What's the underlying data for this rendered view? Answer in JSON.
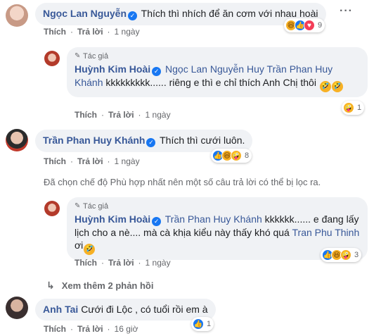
{
  "comments": [
    {
      "name": "Ngọc Lan Nguyễn",
      "text": "Thích thì nhích để ăn cơm với nhau hoài",
      "actions": {
        "like": "Thích",
        "reply": "Trả lời",
        "time": "1 ngày"
      },
      "reactions": {
        "icons": [
          "haha-icon",
          "like-icon",
          "love-icon"
        ],
        "count": "9"
      },
      "avatar_color": "#d9b8a6"
    },
    {
      "author_tag": "Tác giả",
      "name": "Huỳnh Kim Hoài",
      "mention1": "Ngọc Lan Nguyễn Huy",
      "mention2": "Trần Phan Huy Khánh",
      "text": "kkkkkkkkk...... riêng e thì e chỉ thích Anh Chị thôi",
      "actions": {
        "like": "Thích",
        "reply": "Trả lời",
        "time": "1 ngày"
      },
      "reactions": {
        "icons": [
          "care-icon"
        ],
        "count": "1"
      },
      "avatar_color": "#b33a2a"
    },
    {
      "name": "Trần Phan Huy Khánh",
      "text": "Thích thì cưới luôn.",
      "actions": {
        "like": "Thích",
        "reply": "Trả lời",
        "time": "1 ngày"
      },
      "reactions": {
        "icons": [
          "like-icon",
          "haha-icon",
          "care-icon"
        ],
        "count": "8"
      },
      "avatar_color": "#c0392b"
    },
    {
      "author_tag": "Tác giả",
      "name": "Huỳnh Kim Hoài",
      "mention1": "Trần Phan Huy Khánh",
      "text1": "kkkkkk...... e đang lấy lịch cho a nè.... mà cà khịa kiểu này thấy khó quá",
      "mention2": "Tran Phu Thinh",
      "text2": "ơi",
      "actions": {
        "like": "Thích",
        "reply": "Trả lời",
        "time": "1 ngày"
      },
      "reactions": {
        "icons": [
          "like-icon",
          "haha-icon",
          "care-icon"
        ],
        "count": "3"
      },
      "avatar_color": "#b33a2a"
    },
    {
      "name": "Anh Tai",
      "text": "Cưới đi Lộc , có tuổi rồi em à",
      "actions": {
        "like": "Thích",
        "reply": "Trả lời",
        "time": "16 giờ"
      },
      "reactions": {
        "icons": [
          "like-icon"
        ],
        "count": "1"
      },
      "avatar_color": "#5a4a4a"
    }
  ],
  "filter_note": "Đã chọn chế độ Phù hợp nhất nên một số câu trả lời có thể bị lọc ra.",
  "more_replies": "Xem thêm 2 phản hồi",
  "more_options": "···",
  "colors": {
    "name": "#385898",
    "bubble": "#f0f2f5",
    "meta": "#65676b",
    "like": "#1877f2",
    "haha": "#f7b125",
    "love": "#f33e58"
  }
}
